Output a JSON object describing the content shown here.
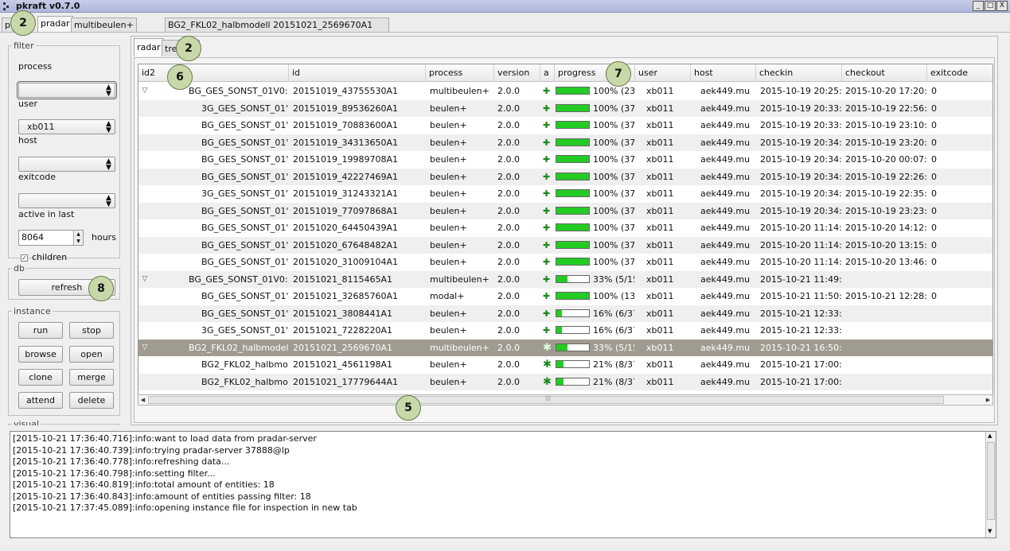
{
  "window": {
    "title": "pkraft v0.7.0",
    "minimize": "_",
    "maximize": "□",
    "close": "X"
  },
  "outer_tabs": [
    "p",
    "pradar",
    "multibeulen+",
    "BG2_FKL02_halbmodell 20151021_2569670A1"
  ],
  "badges": [
    "2",
    "2",
    "6",
    "7",
    "8",
    "5"
  ],
  "filter": {
    "legend": "filter",
    "process_label": "process",
    "process_value": "",
    "user_label": "user",
    "user_value": "xb011",
    "host_label": "host",
    "host_value": "",
    "exitcode_label": "exitcode",
    "exitcode_value": "",
    "active_label": "active in last",
    "active_value": "8064",
    "hours_label": "hours",
    "children_label": "children",
    "children_checked": true
  },
  "db": {
    "legend": "db",
    "refresh_label": "refresh"
  },
  "instance": {
    "legend": "instance",
    "run": "run",
    "stop": "stop",
    "browse": "browse",
    "open": "open",
    "clone": "clone",
    "merge": "merge",
    "attend": "attend",
    "delete": "delete"
  },
  "visual_legend": "visual",
  "inner_tabs": [
    "radar",
    "tre"
  ],
  "table": {
    "headers": [
      "id2",
      "id",
      "process",
      "version",
      "a",
      "progress",
      "user",
      "host",
      "checkin",
      "checkout",
      "exitcode"
    ],
    "rows": [
      {
        "id2": "BG_GES_SONST_01V0:",
        "id": "20151019_43755530A1",
        "process": "multibeulen+",
        "version": "2.0.0",
        "icon": "+",
        "progress": 1.0,
        "ptext": "100% (23,",
        "user": "xb011",
        "host": "aek449.mu",
        "checkin": "2015-10-19 20:25:",
        "checkout": "2015-10-20 17:20:",
        "exitcode": "0",
        "level": 0,
        "expand": true
      },
      {
        "id2": "3G_GES_SONST_01'",
        "id": "20151019_89536260A1",
        "process": "beulen+",
        "version": "2.0.0",
        "icon": "+",
        "progress": 1.0,
        "ptext": "100% (37,",
        "user": "xb011",
        "host": "aek449.mu",
        "checkin": "2015-10-19 20:33:",
        "checkout": "2015-10-19 22:56:",
        "exitcode": "0",
        "level": 1,
        "expand": false
      },
      {
        "id2": "BG_GES_SONST_01'",
        "id": "20151019_70883600A1",
        "process": "beulen+",
        "version": "2.0.0",
        "icon": "+",
        "progress": 1.0,
        "ptext": "100% (37,",
        "user": "xb011",
        "host": "aek449.mu",
        "checkin": "2015-10-19 20:33:",
        "checkout": "2015-10-19 23:10:",
        "exitcode": "0",
        "level": 1,
        "expand": false
      },
      {
        "id2": "BG_GES_SONST_01'",
        "id": "20151019_34313650A1",
        "process": "beulen+",
        "version": "2.0.0",
        "icon": "+",
        "progress": 1.0,
        "ptext": "100% (37,",
        "user": "xb011",
        "host": "aek449.mu",
        "checkin": "2015-10-19 20:34:",
        "checkout": "2015-10-19 23:20:",
        "exitcode": "0",
        "level": 1,
        "expand": false
      },
      {
        "id2": "BG_GES_SONST_01'",
        "id": "20151019_19989708A1",
        "process": "beulen+",
        "version": "2.0.0",
        "icon": "+",
        "progress": 1.0,
        "ptext": "100% (37,",
        "user": "xb011",
        "host": "aek449.mu",
        "checkin": "2015-10-19 20:34:",
        "checkout": "2015-10-20 00:07:",
        "exitcode": "0",
        "level": 1,
        "expand": false
      },
      {
        "id2": "BG_GES_SONST_01'",
        "id": "20151019_42227469A1",
        "process": "beulen+",
        "version": "2.0.0",
        "icon": "+",
        "progress": 1.0,
        "ptext": "100% (37,",
        "user": "xb011",
        "host": "aek449.mu",
        "checkin": "2015-10-19 20:34:",
        "checkout": "2015-10-19 22:26:",
        "exitcode": "0",
        "level": 1,
        "expand": false
      },
      {
        "id2": "3G_GES_SONST_01'",
        "id": "20151019_31243321A1",
        "process": "beulen+",
        "version": "2.0.0",
        "icon": "+",
        "progress": 1.0,
        "ptext": "100% (37,",
        "user": "xb011",
        "host": "aek449.mu",
        "checkin": "2015-10-19 20:34:",
        "checkout": "2015-10-19 22:35:",
        "exitcode": "0",
        "level": 1,
        "expand": false
      },
      {
        "id2": "BG_GES_SONST_01'",
        "id": "20151019_77097868A1",
        "process": "beulen+",
        "version": "2.0.0",
        "icon": "+",
        "progress": 1.0,
        "ptext": "100% (37,",
        "user": "xb011",
        "host": "aek449.mu",
        "checkin": "2015-10-19 20:34:",
        "checkout": "2015-10-19 23:23:",
        "exitcode": "0",
        "level": 1,
        "expand": false
      },
      {
        "id2": "BG_GES_SONST_01'",
        "id": "20151020_64450439A1",
        "process": "beulen+",
        "version": "2.0.0",
        "icon": "+",
        "progress": 1.0,
        "ptext": "100% (37,",
        "user": "xb011",
        "host": "aek449.mu",
        "checkin": "2015-10-20 11:14:",
        "checkout": "2015-10-20 14:12:",
        "exitcode": "0",
        "level": 1,
        "expand": false
      },
      {
        "id2": "BG_GES_SONST_01'",
        "id": "20151020_67648482A1",
        "process": "beulen+",
        "version": "2.0.0",
        "icon": "+",
        "progress": 1.0,
        "ptext": "100% (37,",
        "user": "xb011",
        "host": "aek449.mu",
        "checkin": "2015-10-20 11:14:",
        "checkout": "2015-10-20 13:15:",
        "exitcode": "0",
        "level": 1,
        "expand": false
      },
      {
        "id2": "BG_GES_SONST_01'",
        "id": "20151020_31009104A1",
        "process": "beulen+",
        "version": "2.0.0",
        "icon": "+",
        "progress": 1.0,
        "ptext": "100% (37,",
        "user": "xb011",
        "host": "aek449.mu",
        "checkin": "2015-10-20 11:14:",
        "checkout": "2015-10-20 13:46:",
        "exitcode": "0",
        "level": 1,
        "expand": false
      },
      {
        "id2": "BG_GES_SONST_01V0:",
        "id": "20151021_8115465A1",
        "process": "multibeulen+",
        "version": "2.0.0",
        "icon": "+",
        "progress": 0.33,
        "ptext": "33% (5/15",
        "user": "xb011",
        "host": "aek449.mu",
        "checkin": "2015-10-21 11:49:",
        "checkout": "",
        "exitcode": "",
        "level": 0,
        "expand": true
      },
      {
        "id2": "BG_GES_SONST_01'",
        "id": "20151021_32685760A1",
        "process": "modal+",
        "version": "2.0.0",
        "icon": "+",
        "progress": 1.0,
        "ptext": "100% (13,",
        "user": "xb011",
        "host": "aek449.mu",
        "checkin": "2015-10-21 11:50:",
        "checkout": "2015-10-21 12:28:",
        "exitcode": "0",
        "level": 1,
        "expand": false
      },
      {
        "id2": "BG_GES_SONST_01'",
        "id": "20151021_3808441A1",
        "process": "beulen+",
        "version": "2.0.0",
        "icon": "+",
        "progress": 0.16,
        "ptext": "16% (6/37",
        "user": "xb011",
        "host": "aek449.mu",
        "checkin": "2015-10-21 12:33:",
        "checkout": "",
        "exitcode": "",
        "level": 1,
        "expand": false
      },
      {
        "id2": "3G_GES_SONST_01'",
        "id": "20151021_7228220A1",
        "process": "beulen+",
        "version": "2.0.0",
        "icon": "+",
        "progress": 0.16,
        "ptext": "16% (6/37",
        "user": "xb011",
        "host": "aek449.mu",
        "checkin": "2015-10-21 12:33:",
        "checkout": "",
        "exitcode": "",
        "level": 1,
        "expand": false
      },
      {
        "id2": "BG2_FKL02_halbmodel",
        "id": "20151021_2569670A1",
        "process": "multibeulen+",
        "version": "2.0.0",
        "icon": "run",
        "progress": 0.33,
        "ptext": "33% (5/15",
        "user": "xb011",
        "host": "aek449.mu",
        "checkin": "2015-10-21 16:50:",
        "checkout": "",
        "exitcode": "",
        "level": 0,
        "expand": true,
        "selected": true
      },
      {
        "id2": "BG2_FKL02_halbmo",
        "id": "20151021_4561198A1",
        "process": "beulen+",
        "version": "2.0.0",
        "icon": "run",
        "progress": 0.21,
        "ptext": "21% (8/37",
        "user": "xb011",
        "host": "aek449.mu",
        "checkin": "2015-10-21 17:00:",
        "checkout": "",
        "exitcode": "",
        "level": 1,
        "expand": false
      },
      {
        "id2": "BG2_FKL02_halbmo",
        "id": "20151021_17779644A1",
        "process": "beulen+",
        "version": "2.0.0",
        "icon": "run",
        "progress": 0.21,
        "ptext": "21% (8/37",
        "user": "xb011",
        "host": "aek449.mu",
        "checkin": "2015-10-21 17:00:",
        "checkout": "",
        "exitcode": "",
        "level": 1,
        "expand": false
      }
    ]
  },
  "scroll_mark": "|||",
  "log": [
    "[2015-10-21 17:36:40.716]:info:want to load data from pradar-server",
    "[2015-10-21 17:36:40.739]:info:trying pradar-server 37888@lp",
    "[2015-10-21 17:36:40.778]:info:refreshing data...",
    "[2015-10-21 17:36:40.798]:info:setting filter...",
    "[2015-10-21 17:36:40.819]:info:total amount of entities: 18",
    "[2015-10-21 17:36:40.843]:info:amount of entities passing filter: 18",
    "[2015-10-21 17:37:45.089]:info:opening instance file for inspection in new tab"
  ],
  "colors": {
    "progress": "#22cc22",
    "selected_row": "#a09b90",
    "icon_green": "#1a8a1a"
  }
}
